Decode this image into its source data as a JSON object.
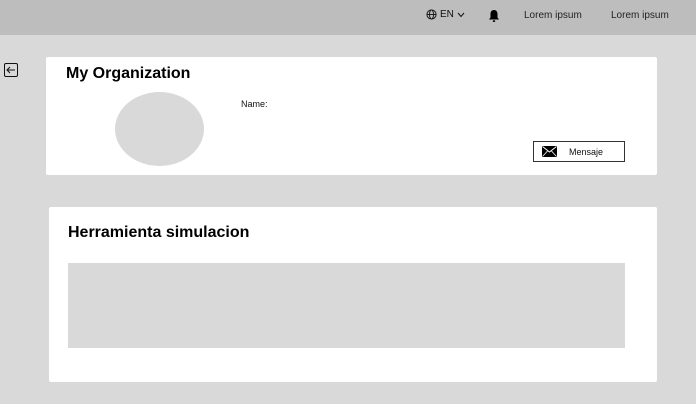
{
  "header": {
    "language": "EN",
    "nav_links": [
      "Lorem ipsum",
      "Lorem ipsum"
    ]
  },
  "organization": {
    "title": "My Organization",
    "name_label": "Name:",
    "message_button": "Mensaje"
  },
  "simulation": {
    "title": "Herramienta simulacion"
  },
  "icons": {
    "language": "globe-icon",
    "language_dropdown": "chevron-down-icon",
    "notifications": "bell-icon",
    "back": "arrow-left-icon",
    "message": "envelope-icon"
  },
  "colors": {
    "page_background": "#d9d9d9",
    "header_background": "#bdbdbd",
    "card_background": "#ffffff",
    "placeholder": "#d9d9d9"
  }
}
